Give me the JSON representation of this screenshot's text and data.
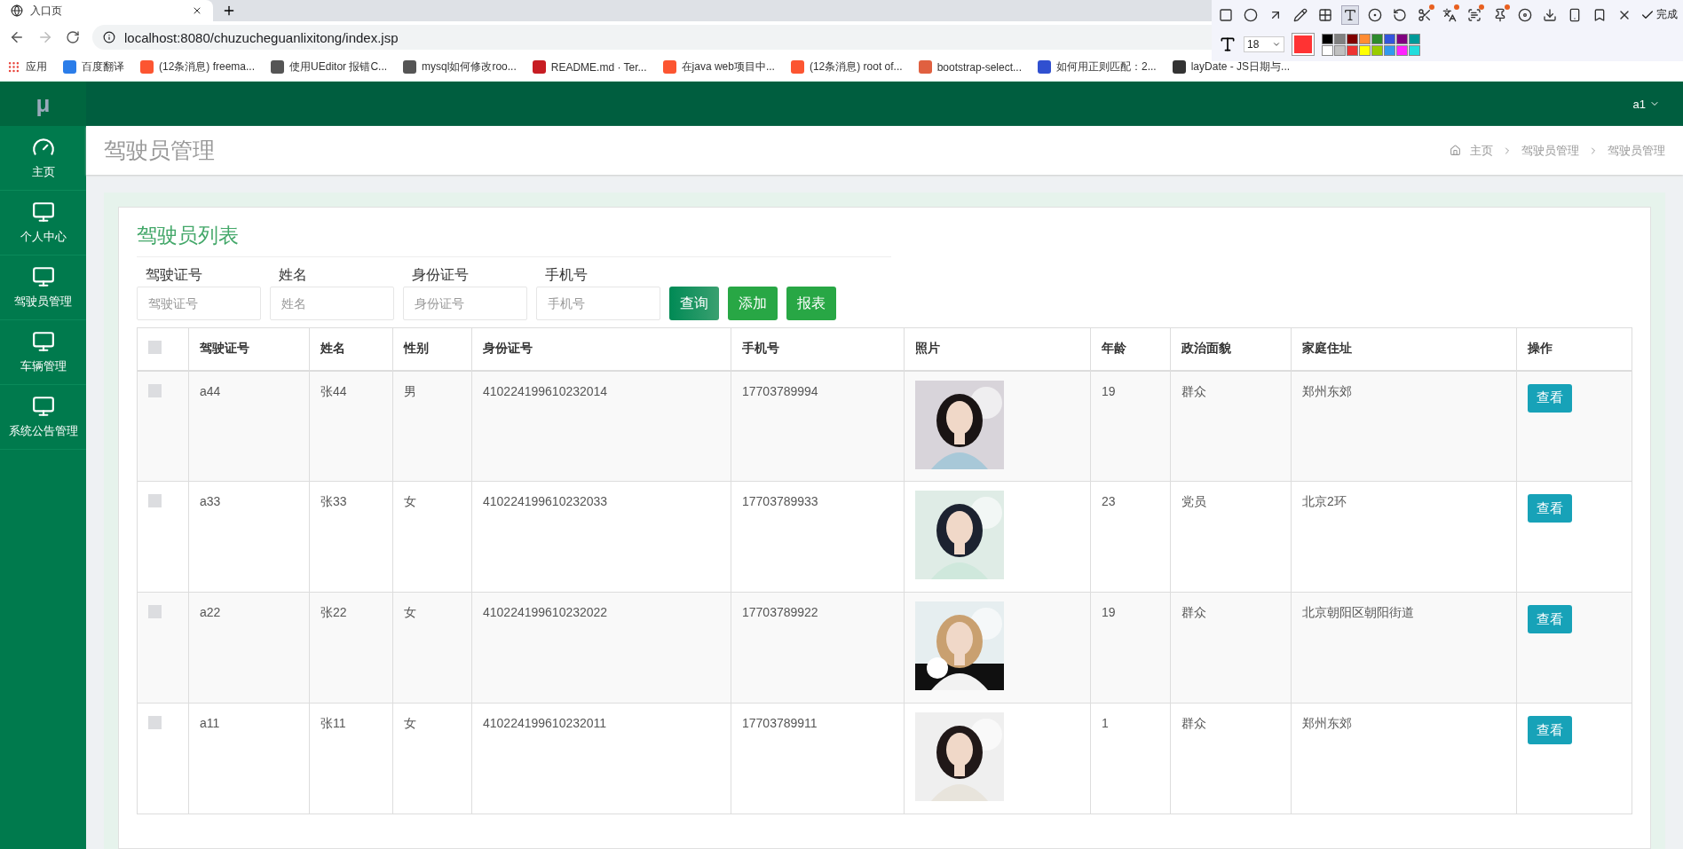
{
  "browser": {
    "tab_title": "入口页",
    "url": "localhost:8080/chuzucheguanlixitong/index.jsp",
    "bookmarks": [
      {
        "label": "应用",
        "kind": "apps"
      },
      {
        "label": "百度翻译",
        "kind": "translate"
      },
      {
        "label": "(12条消息) freema...",
        "kind": "csdn"
      },
      {
        "label": "使用UEditor 报错C...",
        "kind": "bird"
      },
      {
        "label": "mysql如何修改roo...",
        "kind": "bird"
      },
      {
        "label": "README.md · Ter...",
        "kind": "gitee"
      },
      {
        "label": "在java web项目中...",
        "kind": "csdn"
      },
      {
        "label": "(12条消息) root of...",
        "kind": "csdn"
      },
      {
        "label": "bootstrap-select...",
        "kind": "jian"
      },
      {
        "label": "如何用正则匹配：2...",
        "kind": "paw"
      },
      {
        "label": "layDate - JS日期与...",
        "kind": "doc"
      }
    ]
  },
  "capture_toolbar": {
    "tools": [
      {
        "selected": false,
        "badge": false
      },
      {
        "selected": false,
        "badge": false
      },
      {
        "selected": false,
        "badge": false
      },
      {
        "selected": false,
        "badge": false
      },
      {
        "selected": false,
        "badge": false
      },
      {
        "selected": true,
        "badge": false
      },
      {
        "selected": false,
        "badge": false
      },
      {
        "selected": false,
        "badge": false
      },
      {
        "selected": false,
        "badge": true
      },
      {
        "selected": false,
        "badge": true
      },
      {
        "selected": false,
        "badge": true
      },
      {
        "selected": false,
        "badge": true
      },
      {
        "selected": false,
        "badge": false
      },
      {
        "selected": false,
        "badge": false
      },
      {
        "selected": false,
        "badge": false
      },
      {
        "selected": false,
        "badge": false
      },
      {
        "selected": false,
        "badge": false
      }
    ],
    "done_label": "完成",
    "font_size": "18",
    "current": {
      "color": "#ff3333"
    },
    "palette": [
      {
        "color": "#000000"
      },
      {
        "color": "#808080"
      },
      {
        "color": "#800000"
      },
      {
        "color": "#ff8c33"
      },
      {
        "color": "#2e8b2e"
      },
      {
        "color": "#3355dd"
      },
      {
        "color": "#800080"
      },
      {
        "color": "#009999"
      },
      {
        "color": "#ffffff"
      },
      {
        "color": "#c0c0c0"
      },
      {
        "color": "#ee3333"
      },
      {
        "color": "#ffff00"
      },
      {
        "color": "#99cc00"
      },
      {
        "color": "#3399ee"
      },
      {
        "color": "#ff22ff"
      },
      {
        "color": "#22dddd"
      }
    ]
  },
  "app": {
    "logo": "μ",
    "user": "a1"
  },
  "sidebar": [
    {
      "label": "主页",
      "kind": "dashboard"
    },
    {
      "label": "个人中心",
      "kind": "page"
    },
    {
      "label": "驾驶员管理",
      "kind": "page"
    },
    {
      "label": "车辆管理",
      "kind": "page"
    },
    {
      "label": "系统公告管理",
      "kind": "page"
    }
  ],
  "page_title": "驾驶员管理",
  "breadcrumb": [
    "主页",
    "驾驶员管理",
    "驾驶员管理"
  ],
  "card_title": "驾驶员列表",
  "filters": [
    {
      "label": "驾驶证号",
      "placeholder": "驾驶证号"
    },
    {
      "label": "姓名",
      "placeholder": "姓名"
    },
    {
      "label": "身份证号",
      "placeholder": "身份证号"
    },
    {
      "label": "手机号",
      "placeholder": "手机号"
    }
  ],
  "buttons": [
    {
      "label": "查询",
      "kind": "query"
    },
    {
      "label": "添加",
      "kind": "add"
    },
    {
      "label": "报表",
      "kind": "report"
    }
  ],
  "table": {
    "header_checked": false,
    "columns": [
      "驾驶证号",
      "姓名",
      "性别",
      "身份证号",
      "手机号",
      "照片",
      "年龄",
      "政治面貌",
      "家庭住址",
      "操作"
    ],
    "rows": [
      {
        "checked": false,
        "cells": [
          "a44",
          "张44",
          "男",
          "410224199610232014",
          "17703789994"
        ],
        "photo": {
          "kind": "picture"
        },
        "tail": [
          "19",
          "群众",
          "郑州东郊"
        ],
        "action": "查看"
      },
      {
        "checked": false,
        "cells": [
          "a33",
          "张33",
          "女",
          "410224199610232033",
          "17703789933"
        ],
        "photo": {
          "kind": "picture"
        },
        "tail": [
          "23",
          "党员",
          "北京2环"
        ],
        "action": "查看"
      },
      {
        "checked": false,
        "cells": [
          "a22",
          "张22",
          "女",
          "410224199610232022",
          "17703789922"
        ],
        "photo": {
          "kind": "picture"
        },
        "tail": [
          "19",
          "群众",
          "北京朝阳区朝阳街道"
        ],
        "action": "查看"
      },
      {
        "checked": false,
        "cells": [
          "a11",
          "张11",
          "女",
          "410224199610232011",
          "17703789911"
        ],
        "photo": {
          "kind": "picture"
        },
        "tail": [
          "1",
          "群众",
          "郑州东郊"
        ],
        "action": "查看"
      }
    ]
  }
}
